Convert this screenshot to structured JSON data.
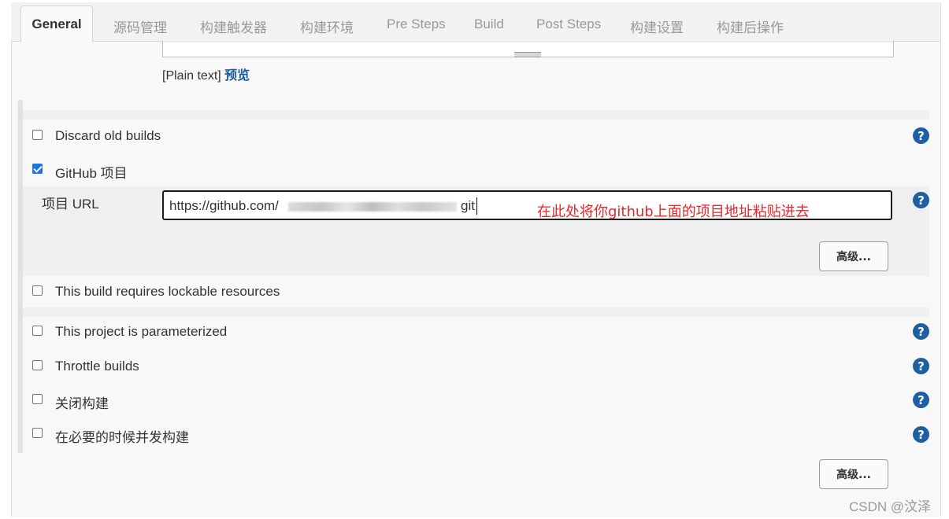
{
  "tabs": [
    "General",
    "源码管理",
    "构建触发器",
    "构建环境",
    "Pre Steps",
    "Build",
    "Post Steps",
    "构建设置",
    "构建后操作"
  ],
  "description": {
    "format_text": "[Plain text]",
    "preview_link": "预览"
  },
  "options": {
    "discard_old_builds": "Discard old builds",
    "github_project": "GitHub 项目",
    "lockable": "This build requires lockable resources",
    "parameterized": "This project is parameterized",
    "throttle": "Throttle builds",
    "disable_build": "关闭构建",
    "concurrent": "在必要的时候并发构建"
  },
  "checked": {
    "github_project": true,
    "discard_old_builds": false
  },
  "github": {
    "url_label": "项目 URL",
    "url_prefix": "https://github.com/",
    "url_suffix": "git",
    "annotation": "在此处将你github上面的项目地址粘贴进去",
    "advanced_button": "高级..."
  },
  "advanced_button": "高级...",
  "help_glyph": "?",
  "watermark": "CSDN @汶泽",
  "colors": {
    "help_icon": "#1d5fa0",
    "annotation": "#e5262a",
    "checkbox_checked": "#1a73e8"
  }
}
